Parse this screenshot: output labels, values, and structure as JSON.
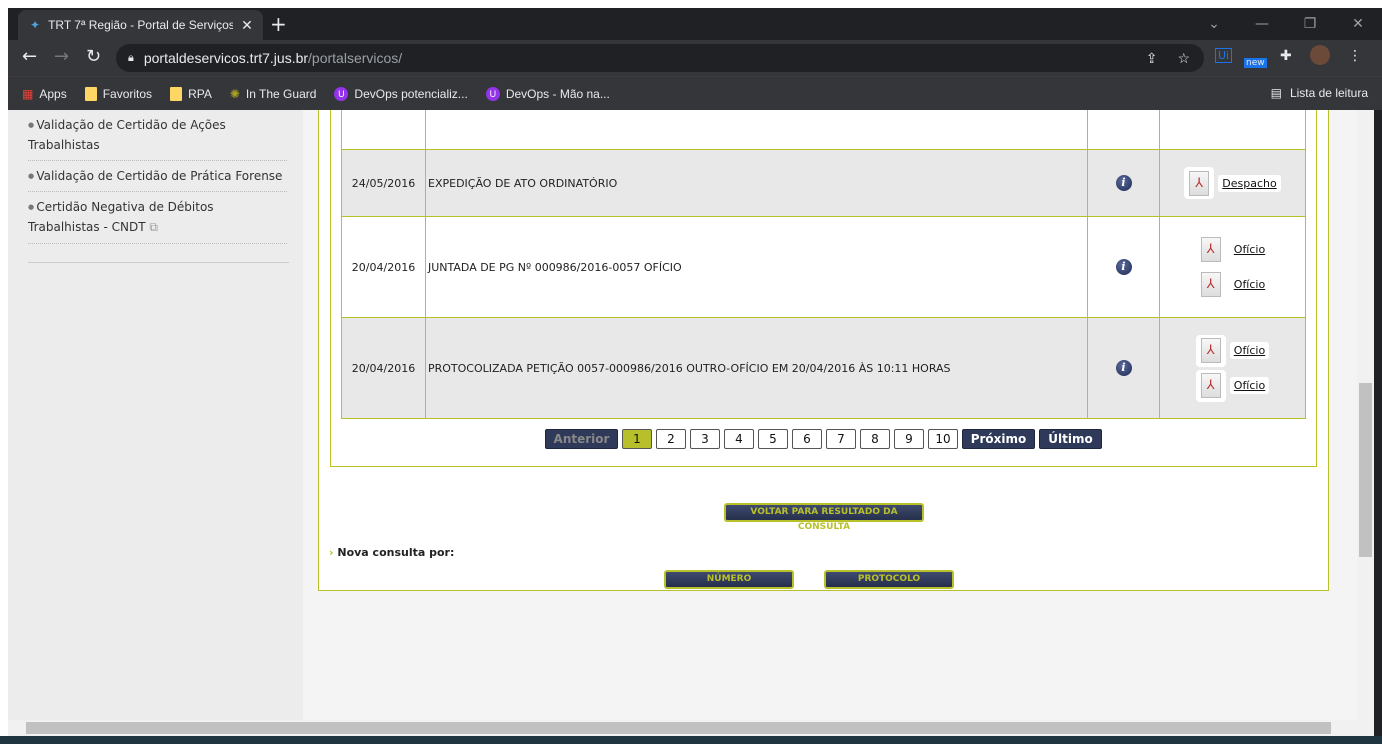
{
  "browser": {
    "tab_title": "TRT 7ª Região - Portal de Serviços",
    "url_host": "portaldeservicos.trt7.jus.br",
    "url_path": "/portalservicos/",
    "bookmarks": [
      "Apps",
      "Favoritos",
      "RPA",
      "In The Guard",
      "DevOps potencializ...",
      "DevOps - Mão na..."
    ],
    "reading_list": "Lista de leitura",
    "ext_badge": "new",
    "ext_ui": "Ui"
  },
  "sidebar": {
    "items": [
      "Validação de Certidão de Ações Trabalhistas",
      "Validação de Certidão de Prática Forense",
      "Certidão Negativa de Débitos Trabalhistas - CNDT"
    ]
  },
  "table": {
    "rows": [
      {
        "date": "24/05/2016",
        "desc": "EXPEDIÇÃO DE ATO ORDINATÓRIO",
        "docs": [
          "Despacho"
        ],
        "shade": "gray"
      },
      {
        "date": "20/04/2016",
        "desc": "JUNTADA DE PG Nº 000986/2016-0057 OFÍCIO",
        "docs": [
          "Ofício",
          "Ofício"
        ],
        "shade": "white"
      },
      {
        "date": "20/04/2016",
        "desc": "PROTOCOLIZADA PETIÇÃO 0057-000986/2016 OUTRO-OFÍCIO EM 20/04/2016 ÀS 10:11 HORAS",
        "docs": [
          "Ofício",
          "Ofício"
        ],
        "shade": "gray"
      }
    ]
  },
  "pagination": {
    "prev": "Anterior",
    "pages": [
      "1",
      "2",
      "3",
      "4",
      "5",
      "6",
      "7",
      "8",
      "9",
      "10"
    ],
    "current": "1",
    "next": "Próximo",
    "last": "Último"
  },
  "actions": {
    "back": "VOLTAR PARA RESULTADO DA CONSULTA",
    "nova": "Nova consulta por:",
    "numero": "NÚMERO",
    "protocolo": "PROTOCOLO"
  },
  "colors": {
    "accent": "#b8c02a",
    "button": "#2f3a5a"
  }
}
